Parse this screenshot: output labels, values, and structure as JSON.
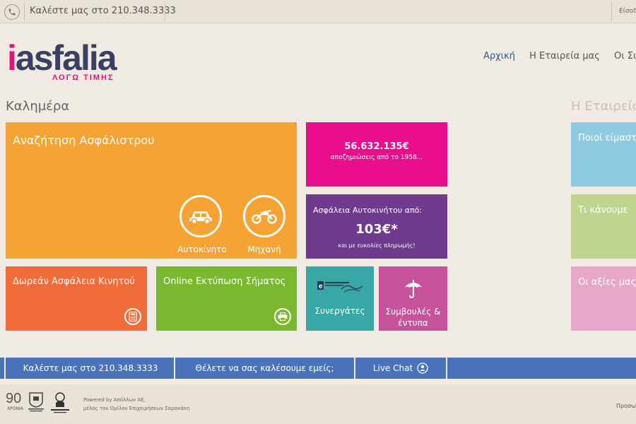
{
  "topbar": {
    "call_text": "Καλέστε μας στο 210.348.3333",
    "login": "Είσοδ"
  },
  "logo": {
    "name_i": "i",
    "name_rest": "asfalia",
    "tagline": "ΛΟΓΩ ΤΙΜΗΣ"
  },
  "nav": {
    "items": [
      "Αρχική",
      "Η Εταιρεία μας",
      "Οι Συνεργά"
    ]
  },
  "greeting": "Καλημέρα",
  "company_heading": "Η Εταιρεία",
  "tiles": {
    "search": {
      "title": "Αναζήτηση Ασφάλιστρου",
      "car_label": "Αυτοκίνητο",
      "moto_label": "Μηχανή"
    },
    "claims": {
      "amount": "56.632.135€",
      "text": "αποζημιώσεις από το 1958..."
    },
    "car_price": {
      "line1": "Ασφάλεια Αυτοκινήτου από:",
      "price": "103€*",
      "note": "και με ευκολίες πληρωμής!"
    },
    "mobile": {
      "title": "Δωρεάν Ασφάλεια Κινητού"
    },
    "print": {
      "title": "Online Εκτύπωση Σήματος"
    },
    "partners": {
      "label": "Συνεργάτες"
    },
    "advice": {
      "label": "Συμβουλές & έντυπα"
    },
    "who": {
      "title": "Ποιοί είμαστε"
    },
    "what": {
      "title": "Τι κάνουμε"
    },
    "values": {
      "title": "Οι αξίες μας"
    }
  },
  "bluebar": {
    "call": "Καλέστε μας στο 210.348.3333",
    "callback": "Θέλετε να σας καλέσουμε εμείς;",
    "chat": "Live Chat"
  },
  "footer": {
    "years": "90",
    "years_label": "ΧΡΟΝΙΑ",
    "powered_line1": "Powered by Απόλλων ΑΕ,",
    "powered_line2": "μέλος του Ομίλου Επιχειρήσεων Σαρακάκη",
    "right_text": "Προσω"
  },
  "colors": {
    "orange": "#f4a334",
    "pink": "#e90e8b",
    "purple": "#6d3a8d",
    "red_orange": "#f06d3a",
    "green": "#79b82f",
    "teal": "#3aa7a7",
    "magenta": "#c8519c",
    "blue_bar": "#4a74b9",
    "brand_navy": "#3b3f63",
    "brand_pink": "#e2127a"
  }
}
